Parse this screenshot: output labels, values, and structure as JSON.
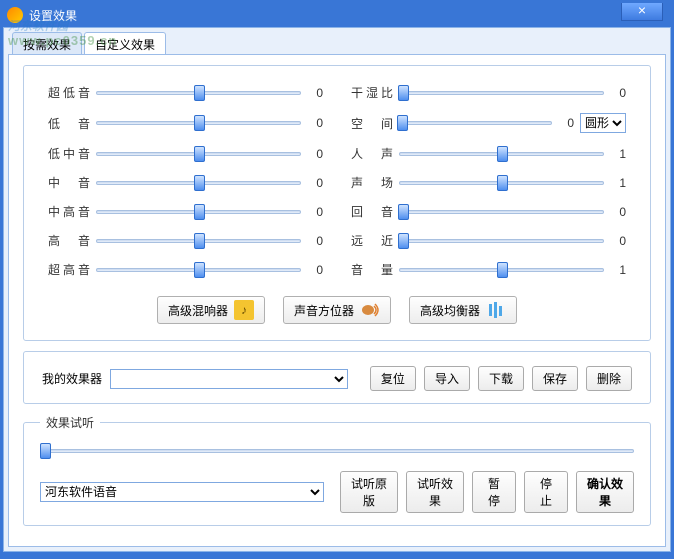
{
  "window": {
    "title": "设置效果",
    "close": "×"
  },
  "watermark": {
    "line1": "河东软件园",
    "line2": "www.pc0359.cn"
  },
  "tabs": {
    "preset": "按需效果",
    "custom": "自定义效果"
  },
  "eq_left": [
    {
      "label": "超低音",
      "value": 0,
      "pos": 50
    },
    {
      "label": "低 音",
      "value": 0,
      "pos": 50
    },
    {
      "label": "低中音",
      "value": 0,
      "pos": 50
    },
    {
      "label": "中 音",
      "value": 0,
      "pos": 50
    },
    {
      "label": "中高音",
      "value": 0,
      "pos": 50
    },
    {
      "label": "高 音",
      "value": 0,
      "pos": 50
    },
    {
      "label": "超高音",
      "value": 0,
      "pos": 50
    }
  ],
  "eq_right": [
    {
      "label": "干湿比",
      "value": 0,
      "pos": 2,
      "extra": false
    },
    {
      "label": "空 间",
      "value": 0,
      "pos": 2,
      "extra": true,
      "select": "圆形"
    },
    {
      "label": "人 声",
      "value": 1,
      "pos": 50,
      "extra": false
    },
    {
      "label": "声 场",
      "value": 1,
      "pos": 50,
      "extra": false
    },
    {
      "label": "回 音",
      "value": 0,
      "pos": 2,
      "extra": false
    },
    {
      "label": "远 近",
      "value": 0,
      "pos": 2,
      "extra": false
    },
    {
      "label": "音 量",
      "value": 1,
      "pos": 50,
      "extra": false
    }
  ],
  "mid_buttons": {
    "reverb": "高级混响器",
    "pan": "声音方位器",
    "eq": "高级均衡器"
  },
  "myfx": {
    "label": "我的效果器",
    "reset": "复位",
    "import": "导入",
    "download": "下载",
    "save": "保存",
    "delete": "删除"
  },
  "try": {
    "legend": "效果试听",
    "voice": "河东软件语音",
    "orig": "试听原版",
    "fx": "试听效果",
    "pause": "暂停",
    "stop": "停止",
    "confirm": "确认效果"
  }
}
